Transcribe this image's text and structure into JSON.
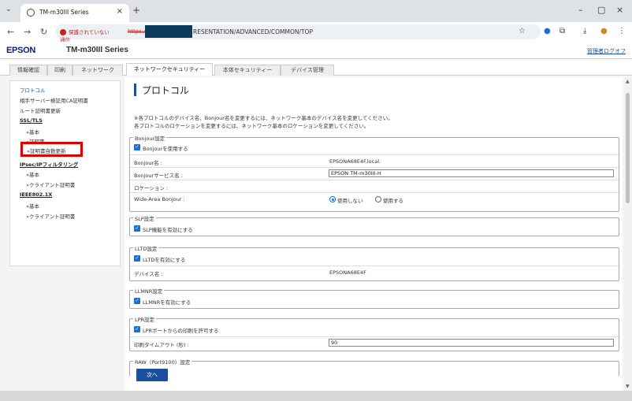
{
  "browser": {
    "tab_title": "TM-m30III Series",
    "new_tab": "+",
    "security_warning": "保護されていない通信",
    "url_protocol": "https://",
    "url_path": "RESENTATION/ADVANCED/COMMON/TOP"
  },
  "header": {
    "logo": "EPSON",
    "model": "TM-m30III Series",
    "logout": "管理者ログオフ"
  },
  "tabs": [
    {
      "label": "情報確認"
    },
    {
      "label": "印刷"
    },
    {
      "label": "ネットワーク"
    },
    {
      "label": "ネットワークセキュリティー"
    },
    {
      "label": "本体セキュリティー"
    },
    {
      "label": "デバイス管理"
    }
  ],
  "sidebar": {
    "protocol": "プロトコル",
    "ca_cert": "相手サーバー検証用CA証明書",
    "root_cert": "ルート証明書更新",
    "ssl_tls": "SSL/TLS",
    "ssl_basic": "»基本",
    "ssl_cert": "»証明書",
    "ssl_auto_renew": "»証明書自動更新",
    "ipsec": "IPsec/IPフィルタリング",
    "ipsec_basic": "»基本",
    "ipsec_client": "»クライアント証明書",
    "ieee": "IEEE802.1X",
    "ieee_basic": "»基本",
    "ieee_client": "»クライアント証明書"
  },
  "main": {
    "title": "プロトコル",
    "note1": "※各プロトコルのデバイス名、Bonjour名を変更するには、ネットワーク基本のデバイス名を変更してください。",
    "note2": "各プロトコルのロケーションを変更するには、ネットワーク基本のロケーションを変更してください。",
    "bonjour": {
      "legend": "Bonjour設定",
      "enable": "Bonjourを使用する",
      "name_label": "Bonjour名 :",
      "name_value": "EPSONA68E4F.local.",
      "service_label": "Bonjourサービス名 :",
      "service_value": "EPSON TM-m30III-H",
      "location_label": "ロケーション :",
      "wide_label": "Wide-Area Bonjour :",
      "wide_off": "使用しない",
      "wide_on": "使用する"
    },
    "slp": {
      "legend": "SLP設定",
      "enable": "SLP機能を有効にする"
    },
    "lltd": {
      "legend": "LLTD設定",
      "enable": "LLTDを有効にする",
      "device_label": "デバイス名 :",
      "device_value": "EPSONA68E4F"
    },
    "llmnr": {
      "legend": "LLMNR設定",
      "enable": "LLMNRを有効にする"
    },
    "lpr": {
      "legend": "LPR設定",
      "enable": "LPRポートからの印刷を許可する",
      "timeout_label": "印刷タイムアウト (秒) :",
      "timeout_value": "90"
    },
    "raw": {
      "legend": "RAW（Port9100）設定"
    },
    "next": "次へ"
  }
}
